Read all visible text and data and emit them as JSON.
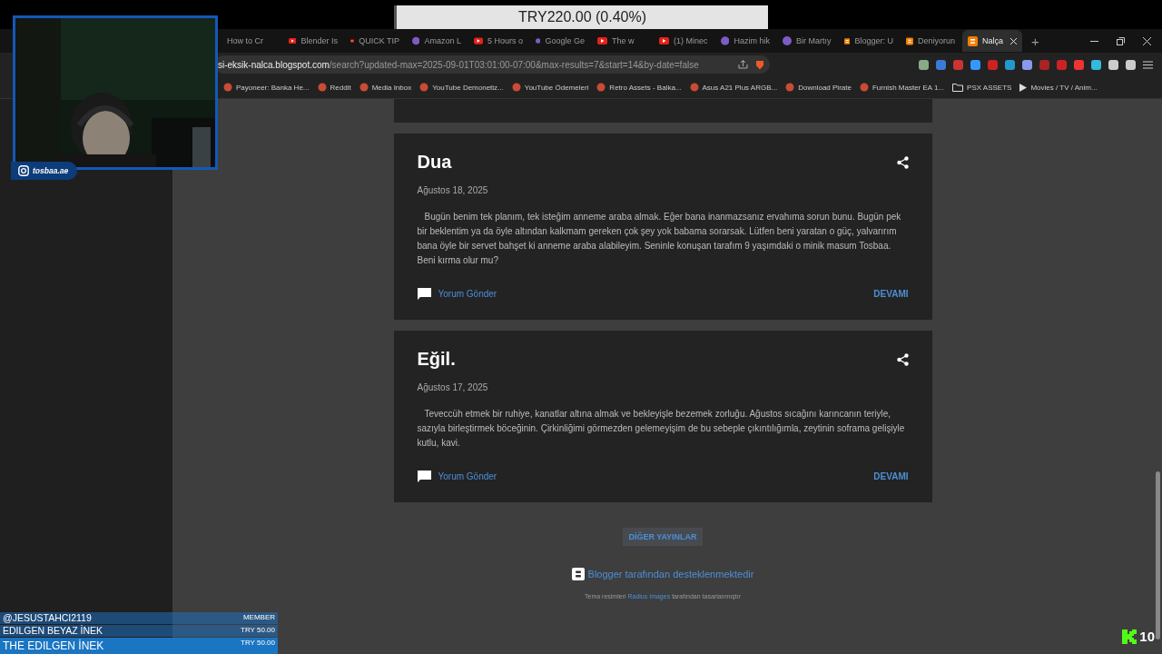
{
  "browser": {
    "tabs": [
      {
        "label": "How to Cr",
        "kind": "plain",
        "selected": false
      },
      {
        "label": "Blender Is",
        "kind": "video",
        "selected": false
      },
      {
        "label": "QUICK TIP",
        "kind": "video",
        "selected": false
      },
      {
        "label": "Amazon L",
        "kind": "site",
        "selected": false
      },
      {
        "label": "5 Hours o",
        "kind": "video",
        "selected": false
      },
      {
        "label": "Google Ge",
        "kind": "site",
        "selected": false
      },
      {
        "label": "The w",
        "kind": "video",
        "selected": false
      },
      {
        "label": "(1) Minec",
        "kind": "video",
        "selected": false
      },
      {
        "label": "Hazim hik",
        "kind": "site",
        "selected": false
      },
      {
        "label": "Bir Martıy",
        "kind": "site",
        "selected": false
      },
      {
        "label": "Blogger: U",
        "kind": "blog",
        "selected": false
      },
      {
        "label": "Deniyorun",
        "kind": "blog",
        "selected": false
      },
      {
        "label": "Nalça",
        "kind": "blog",
        "selected": true
      }
    ],
    "new_tab": "+",
    "address": {
      "host": "si-eksik-nalca.blogspot.com",
      "path": "/search?updated-max=2025-09-01T03:01:00-07:00&max-results=7&start=14&by-date=false"
    },
    "bookmarks": [
      {
        "label": "Payoneer: Banka He...",
        "kind": "site"
      },
      {
        "label": "Reddit",
        "kind": "site"
      },
      {
        "label": "Media Inbox",
        "kind": "site"
      },
      {
        "label": "YouTube Demonetiz...",
        "kind": "site"
      },
      {
        "label": "YouTube Ödemeleri",
        "kind": "site"
      },
      {
        "label": "Retro Assets - Balka...",
        "kind": "site"
      },
      {
        "label": "Asus A21 Plus ARGB...",
        "kind": "site"
      },
      {
        "label": "Download Pirate",
        "kind": "site"
      },
      {
        "label": "Furnish Master EA 1...",
        "kind": "site"
      },
      {
        "label": "PSX ASSETS",
        "kind": "folder"
      },
      {
        "label": "Movies / TV / Anim...",
        "kind": "media"
      }
    ]
  },
  "blog": {
    "posts": [
      {
        "title": "Dua",
        "date": "Ağustos 18, 2025",
        "body": "Bugün benim tek planım, tek isteğim anneme araba almak. Eğer bana inanmazsanız ervahıma sorun bunu. Bugün pek bir beklentim ya da öyle altından kalkmam gereken çok şey yok babama sorarsak. Lütfen beni yaratan o güç, yalvarırım bana öyle bir servet bahşet ki anneme araba alabileyim. Seninle konuşan tarafım 9 yaşımdaki o minik masum Tosbaa. Beni kırma olur mu?",
        "comment": "Yorum Gönder",
        "more": "DEVAMI"
      },
      {
        "title": "Eğil.",
        "date": "Ağustos 17, 2025",
        "body": "Teveccüh etmek bir ruhiye, kanatlar altına almak ve bekleyişle bezemek zorluğu. Ağustos sıcağını karıncanın teriyle, sazıyla birleştirmek böceğinin. Çirkinliğimi görmezden gelemeyişim de bu sebeple çıkıntılığımla, zeytinin soframa gelişiyle kutlu, kavi.",
        "comment": "Yorum Gönder",
        "more": "DEVAMI"
      }
    ],
    "more_posts": "DİĞER YAYINLAR",
    "powered_by": "Blogger tarafından desteklenmektedir",
    "credit_before": "Tema resimleri",
    "credit_link": "Radius Images",
    "credit_after": "tarafından tasarlanmıştır"
  },
  "stream_overlay": {
    "donation_goal": "TRY220.00 (0.40%)",
    "social_handle": "tosbaa.ae",
    "alerts": [
      {
        "kind": "small",
        "name": "@JESUSTAHCI2119",
        "amount": "MEMBER"
      },
      {
        "kind": "small",
        "name": "EDILGEN BEYAZ İNEK",
        "amount": "TRY 50.00"
      },
      {
        "kind": "large",
        "name": "THE EDILGEN İNEK",
        "amount": "TRY 50.00"
      }
    ],
    "counter": "10"
  }
}
